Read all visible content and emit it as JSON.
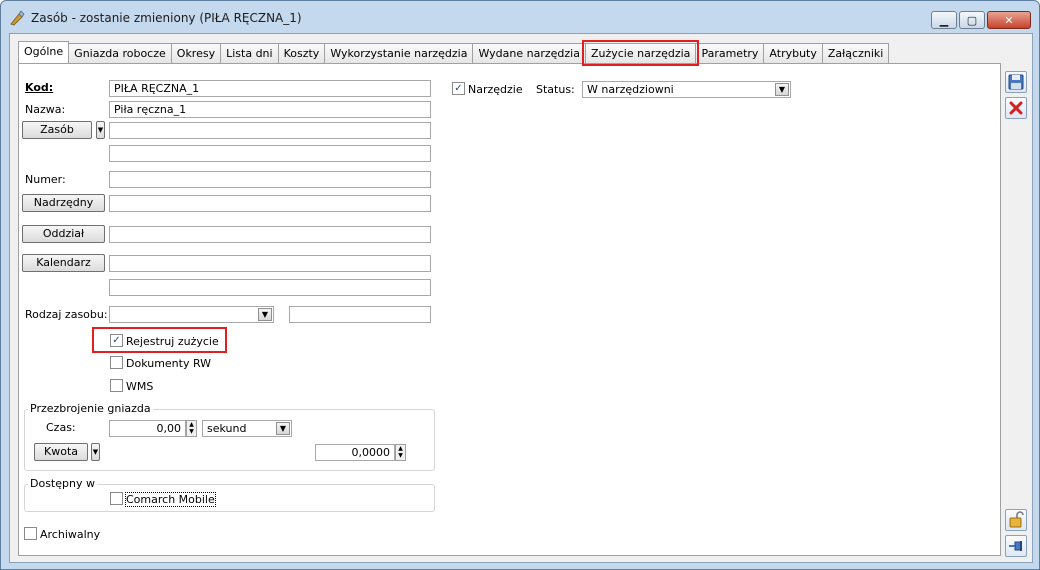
{
  "window": {
    "title": "Zasób - zostanie zmieniony  (PIŁA RĘCZNA_1)",
    "minimize": "▁",
    "maximize": "▢",
    "close": "✕"
  },
  "tabs": [
    "Ogólne",
    "Gniazda robocze",
    "Okresy",
    "Lista dni",
    "Koszty",
    "Wykorzystanie narzędzia",
    "Wydane narzędzia",
    "Zużycie narzędzia",
    "Parametry",
    "Atrybuty",
    "Załączniki"
  ],
  "form": {
    "kod_label": "Kod:",
    "kod_value": "PIŁA RĘCZNA_1",
    "nazwa_label": "Nazwa:",
    "nazwa_value": "Piła ręczna_1",
    "zasob_button": "Zasób",
    "numer_label": "Numer:",
    "nadrzedny_button": "Nadrzędny",
    "oddzial_button": "Oddział",
    "kalendarz_button": "Kalendarz",
    "rodzaj_label": "Rodzaj zasobu:",
    "rejestruj_label": "Rejestruj zużycie",
    "rejestruj_checked": true,
    "dokumenty_label": "Dokumenty RW",
    "dokumenty_checked": false,
    "wms_label": "WMS",
    "wms_checked": false,
    "narzedzie_label": "Narzędzie",
    "narzedzie_checked": true,
    "status_label": "Status:",
    "status_value": "W narzędziowni",
    "przezbrojenie_title": "Przezbrojenie gniazda",
    "czas_label": "Czas:",
    "czas_value": "0,00",
    "czas_unit": "sekund",
    "kwota_button": "Kwota",
    "kwota_value": "0,0000",
    "dostepny_title": "Dostępny w",
    "comarch_label": "Comarch Mobile",
    "comarch_checked": false,
    "archiwalny_label": "Archiwalny",
    "archiwalny_checked": false
  },
  "side": {
    "save": "save-icon",
    "cancel": "cancel-icon",
    "lock": "lock-icon",
    "pin": "pin-icon"
  },
  "colors": {
    "highlight": "#e02020",
    "titlebar": "#c5d9ee"
  }
}
